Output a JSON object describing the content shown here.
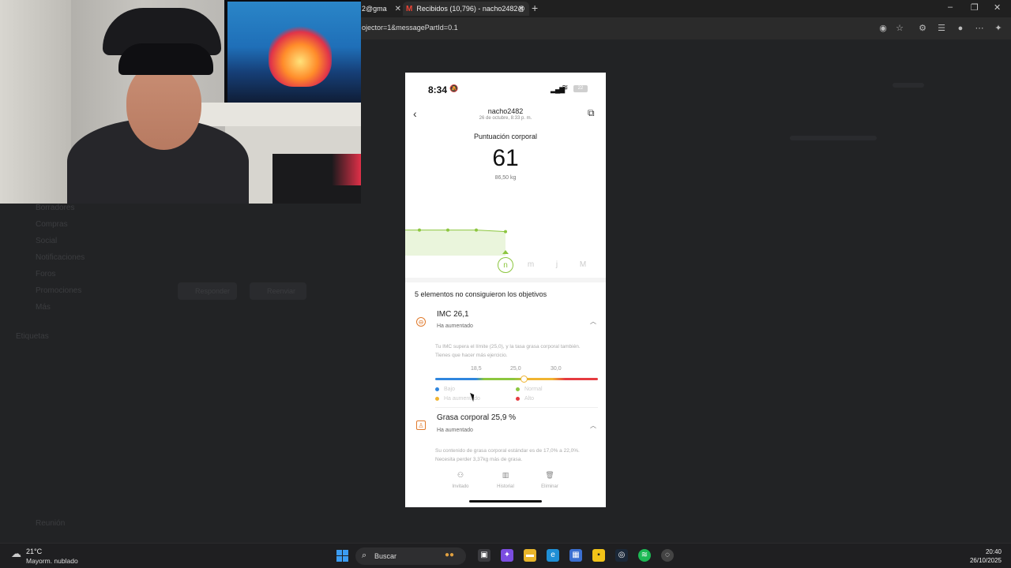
{
  "browser": {
    "tabs": [
      {
        "label": "2@gma"
      },
      {
        "label": "Recibidos (10,796) - nacho2482@"
      }
    ],
    "url": "ojector=1&messagePartId=0.1"
  },
  "gmail_background": {
    "sidebar": [
      "Borradores",
      "Compras",
      "Social",
      "Notificaciones",
      "Foros",
      "Promociones",
      "Más"
    ],
    "section": "Etiquetas",
    "bottom": "Reunión",
    "buttons": [
      "Responder",
      "Reenviar"
    ]
  },
  "phone": {
    "status": {
      "time": "8:34",
      "battery": "22"
    },
    "header": {
      "user": "nacho2482",
      "date": "26 de octubre, 8:33 p. m."
    },
    "score_label": "Puntuación corporal",
    "score": "61",
    "weight": "86,50 kg",
    "chart_data": {
      "type": "line",
      "values": [
        61,
        61,
        61,
        61
      ],
      "color": "#8cc63f"
    },
    "day_pills": [
      {
        "label": "n",
        "active": true
      },
      {
        "label": "m",
        "active": false
      },
      {
        "label": "j",
        "active": false
      },
      {
        "label": "M",
        "active": false
      }
    ],
    "fail_title": "5 elementos no consiguieron los objetivos",
    "items": [
      {
        "name": "IMC 26,1",
        "status": "Ha aumentado",
        "desc": "Tu IMC supera el límite (25,0), y la tasa grasa corporal también. Tienes que hacer más ejercicio.",
        "icon": "bmi-icon"
      },
      {
        "name": "Grasa corporal 25,9 %",
        "status": "Ha aumentado",
        "desc": "Su contenido de grasa corporal estándar es de 17,0% a 22,0%. Necesita perder 3,37kg más de grasa.",
        "icon": "body-fat-icon"
      }
    ],
    "bmi_scale": {
      "ticks": [
        "18,5",
        "25,0",
        "30,0"
      ],
      "value": 26.1,
      "legend": [
        {
          "label": "Bajo",
          "color": "#2f86de"
        },
        {
          "label": "Normal",
          "color": "#8cc63f"
        },
        {
          "label": "Ha aumentado",
          "color": "#f0b431"
        },
        {
          "label": "Alto",
          "color": "#e53b40"
        }
      ]
    },
    "bottom_nav": [
      {
        "label": "Invitado",
        "icon": "person-icon"
      },
      {
        "label": "Historial",
        "icon": "bar-chart-icon"
      },
      {
        "label": "Eliminar",
        "icon": "trash-icon"
      }
    ]
  },
  "taskbar": {
    "weather_temp": "21°C",
    "weather_desc": "Mayorm. nublado",
    "search": "Buscar",
    "time": "20:40",
    "date": "26/10/2025"
  }
}
